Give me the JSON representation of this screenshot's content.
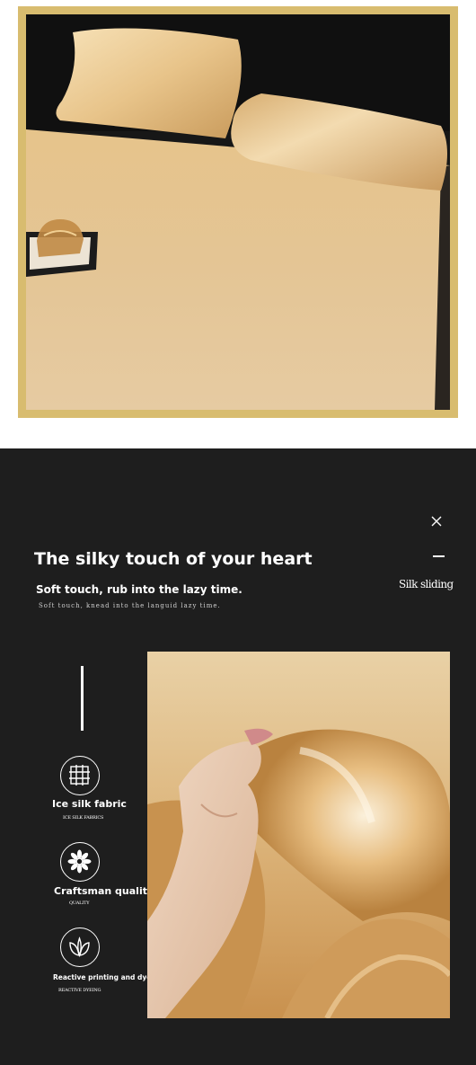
{
  "headline": "The silky touch of your heart",
  "tagline": "Soft touch, rub into the lazy time.",
  "tagline_sub": "Soft touch, knead into the languid lazy time.",
  "side_label": "Silk sliding",
  "features": [
    {
      "label": "Ice silk fabric",
      "sub": "ICE SILK FABRICS",
      "icon": "grid-icon"
    },
    {
      "label": "Craftsman quality",
      "sub": "QUALITY",
      "icon": "flower-icon"
    },
    {
      "label": "Reactive printing and dyeing",
      "sub": "REACTIVE DYEING",
      "icon": "leaf-icon"
    }
  ],
  "colors": {
    "frame": "#d8bc6f",
    "panel": "#1e1e1e",
    "silk": "#e8c690"
  }
}
